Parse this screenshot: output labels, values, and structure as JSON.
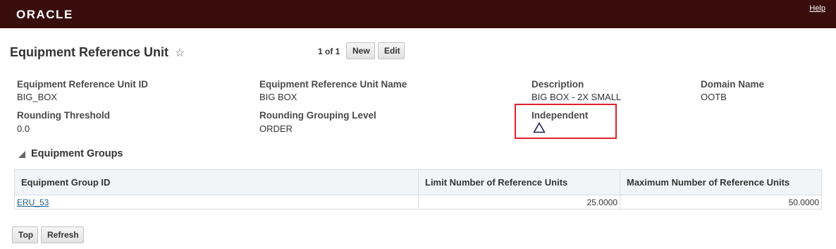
{
  "header": {
    "logo_text": "ORACLE",
    "help_label": "Help"
  },
  "page": {
    "title": "Equipment Reference Unit",
    "favorite_icon": "star-outline-icon"
  },
  "toolbar": {
    "pager": "1 of 1",
    "new_label": "New",
    "edit_label": "Edit"
  },
  "fields": {
    "eru_id": {
      "label": "Equipment Reference Unit ID",
      "value": "BIG_BOX"
    },
    "eru_name": {
      "label": "Equipment Reference Unit Name",
      "value": "BIG BOX"
    },
    "description": {
      "label": "Description",
      "value": "BIG BOX - 2X SMALL"
    },
    "domain": {
      "label": "Domain Name",
      "value": "OOTB"
    },
    "rounding_threshold": {
      "label": "Rounding Threshold",
      "value": "0.0"
    },
    "rounding_grouping": {
      "label": "Rounding Grouping Level",
      "value": "ORDER"
    },
    "independent": {
      "label": "Independent",
      "icon": "triangle-outline-icon"
    }
  },
  "section": {
    "title": "Equipment Groups",
    "toggle_icon": "collapse-triangle-icon"
  },
  "table": {
    "columns": [
      "Equipment Group ID",
      "Limit Number of Reference Units",
      "Maximum Number of Reference Units"
    ],
    "rows": [
      [
        "ERU_53",
        "25.0000",
        "50.0000"
      ]
    ]
  },
  "footer": {
    "top_label": "Top",
    "refresh_label": "Refresh"
  },
  "colors": {
    "header_bg": "#3a0d0d",
    "highlight_border": "#e0202a",
    "link": "#1f5c8a"
  }
}
